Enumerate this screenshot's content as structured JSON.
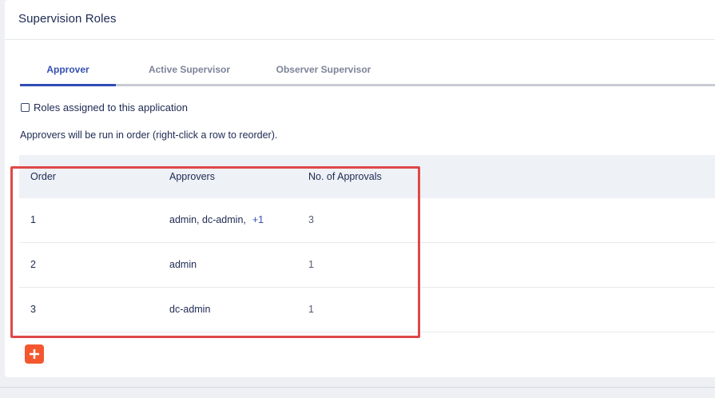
{
  "panel": {
    "title": "Supervision Roles"
  },
  "tabs": [
    {
      "label": "Approver",
      "active": true
    },
    {
      "label": "Active Supervisor",
      "active": false
    },
    {
      "label": "Observer Supervisor",
      "active": false
    }
  ],
  "roles_checkbox": {
    "label": "Roles assigned to this application",
    "checked": false
  },
  "hint_text": "Approvers will be run in order (right-click a row to reorder).",
  "table": {
    "headers": [
      "Order",
      "Approvers",
      "No. of Approvals"
    ],
    "rows": [
      {
        "order": "1",
        "approvers": "admin, dc-admin,",
        "more": "+1",
        "approvals": "3"
      },
      {
        "order": "2",
        "approvers": "admin",
        "more": "",
        "approvals": "1"
      },
      {
        "order": "3",
        "approvers": "dc-admin",
        "more": "",
        "approvals": "1"
      }
    ]
  },
  "add_button": {
    "icon": "plus-icon",
    "color": "#f4572e"
  },
  "colors": {
    "accent": "#2f4db8",
    "highlight": "#e04848"
  }
}
